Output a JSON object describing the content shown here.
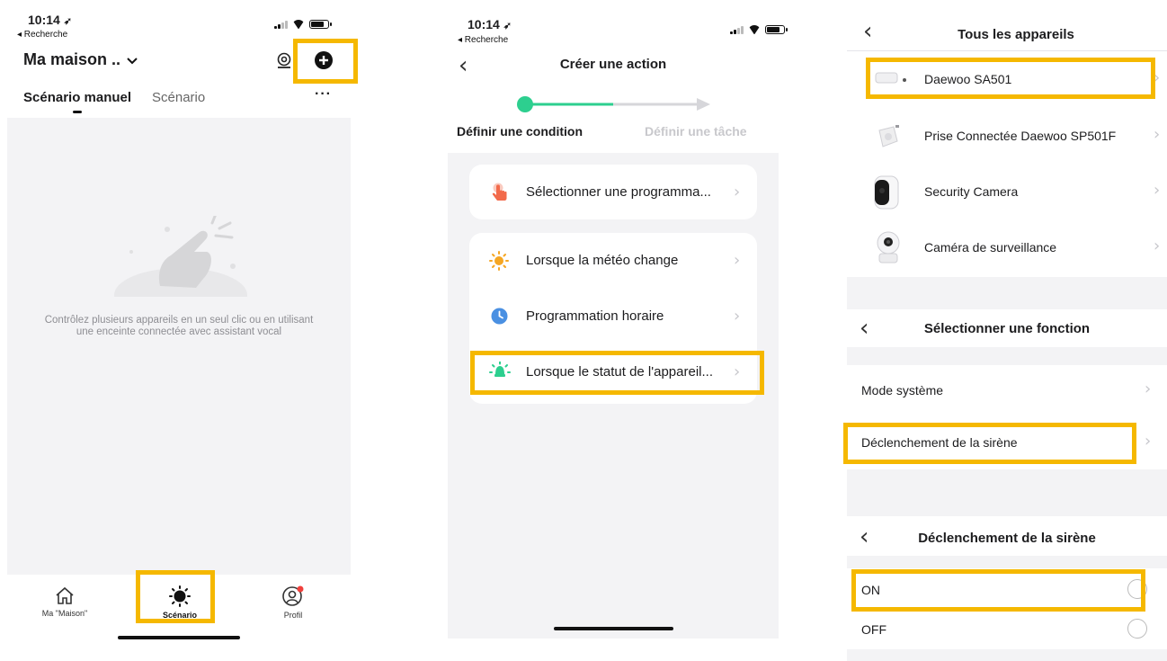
{
  "screen1": {
    "status_time": "10:14",
    "back_app": "◂ Recherche",
    "title": "Ma maison ..",
    "tabs": [
      "Scénario manuel",
      "Scénario"
    ],
    "more": "···",
    "empty_description": "Contrôlez plusieurs appareils en un seul clic ou en utilisant une enceinte connectée avec assistant vocal",
    "tabbar": [
      {
        "label": "Ma \"Maison\"",
        "icon": "home-icon"
      },
      {
        "label": "Scénario",
        "icon": "scenario-sun-icon"
      },
      {
        "label": "Profil",
        "icon": "profile-icon"
      }
    ],
    "icons": {
      "monitor": "camera-monitor-icon",
      "add": "add-circle-icon",
      "title_caret": "chevron-down-icon"
    }
  },
  "screen2": {
    "status_time": "10:14",
    "back_app": "◂ Recherche",
    "title": "Créer une action",
    "step1": "Définir une condition",
    "step2": "Définir une tâche",
    "rows": [
      {
        "label": "Sélectionner une programma...",
        "icon": "tap-hand-icon",
        "color": "#f26a4b"
      },
      {
        "label": "Lorsque la météo change",
        "icon": "sun-icon",
        "color": "#f5a623"
      },
      {
        "label": "Programmation horaire",
        "icon": "clock-icon",
        "color": "#4a90e2"
      },
      {
        "label": "Lorsque le statut de l'appareil...",
        "icon": "device-status-icon",
        "color": "#2dcf8f"
      }
    ]
  },
  "screen3": {
    "devices_title": "Tous les appareils",
    "devices": [
      {
        "name": "Daewoo SA501"
      },
      {
        "name": "Prise Connectée Daewoo SP501F"
      },
      {
        "name": "Security Camera"
      },
      {
        "name": "Caméra de surveillance"
      }
    ],
    "function_title": "Sélectionner une fonction",
    "functions": [
      "Mode système",
      "Déclenchement de la sirène"
    ],
    "siren_title": "Déclenchement de la sirène",
    "options": [
      "ON",
      "OFF"
    ]
  },
  "colors": {
    "highlight": "#f5b800",
    "accent": "#2dcf8f",
    "background": "#f3f3f5"
  }
}
